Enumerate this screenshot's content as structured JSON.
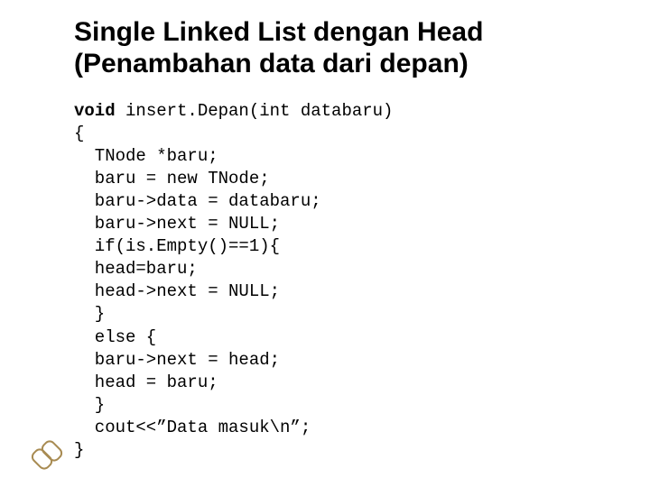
{
  "title": {
    "line1": "Single Linked List dengan Head",
    "line2": "(Penambahan data dari depan)"
  },
  "code": {
    "kw_void": "void",
    "sig": " insert.Depan(int databaru)",
    "open": "{",
    "l1": "TNode *baru;",
    "l2": "baru = new TNode;",
    "l3": "baru->data = databaru;",
    "l4": "baru->next = NULL;",
    "l5": "if(is.Empty()==1){",
    "l6": "head=baru;",
    "l7": "head->next = NULL;",
    "l8": "}",
    "l9": "else {",
    "l10": "baru->next = head;",
    "l11": "head = baru;",
    "l12": "}",
    "l13": "cout<<”Data masuk\\n”;",
    "close": "}"
  },
  "icon": {
    "name": "chain-link-icon"
  }
}
